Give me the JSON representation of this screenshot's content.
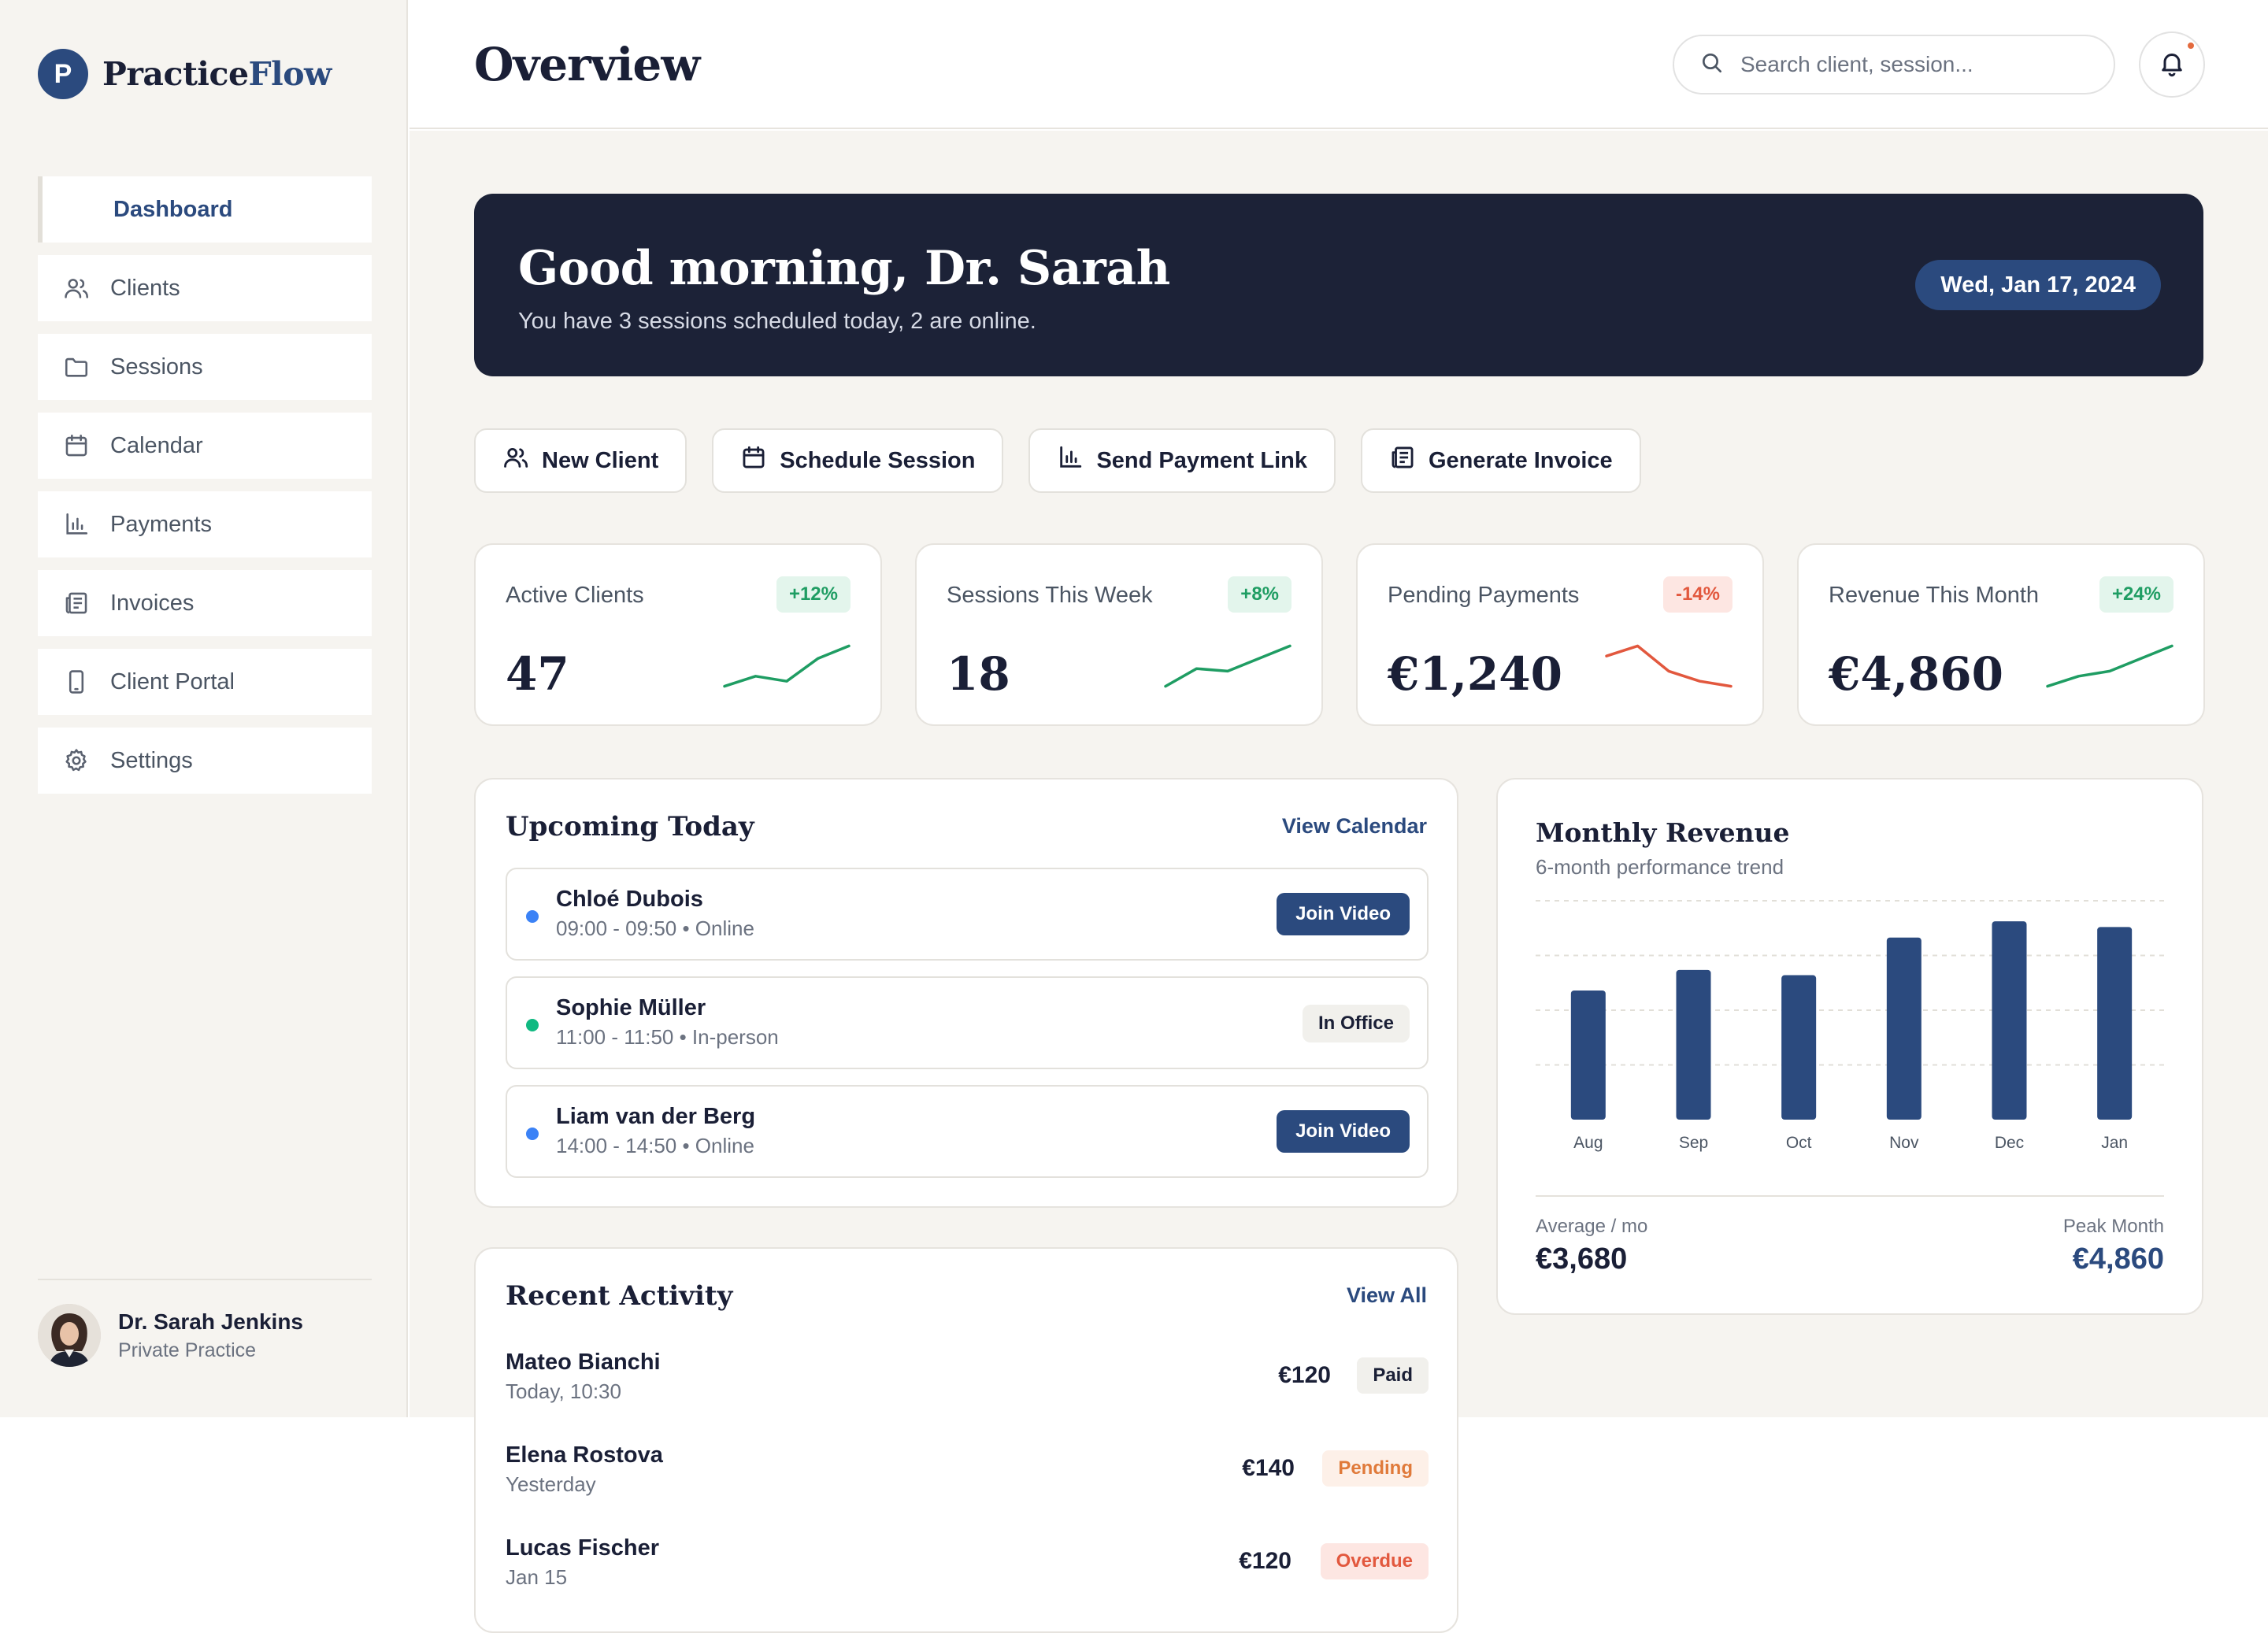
{
  "brand": {
    "logo_letter": "P",
    "name_part1": "Practice",
    "name_part2": "Flow"
  },
  "sidebar": {
    "items": [
      {
        "label": "Dashboard",
        "icon": "none",
        "active": true
      },
      {
        "label": "Clients",
        "icon": "users-icon"
      },
      {
        "label": "Sessions",
        "icon": "folder-icon"
      },
      {
        "label": "Calendar",
        "icon": "calendar-icon"
      },
      {
        "label": "Payments",
        "icon": "bar-chart-icon"
      },
      {
        "label": "Invoices",
        "icon": "newspaper-icon"
      },
      {
        "label": "Client Portal",
        "icon": "phone-icon"
      },
      {
        "label": "Settings",
        "icon": "gear-icon"
      }
    ]
  },
  "profile": {
    "name": "Dr. Sarah Jenkins",
    "subtitle": "Private Practice"
  },
  "header": {
    "title": "Overview",
    "search_placeholder": "Search client, session..."
  },
  "hero": {
    "greeting": "Good morning, Dr. Sarah",
    "subtitle": "You have 3 sessions scheduled today, 2 are online.",
    "date": "Wed, Jan 17, 2024"
  },
  "actions": [
    {
      "label": "New Client",
      "icon": "users-icon"
    },
    {
      "label": "Schedule Session",
      "icon": "calendar-icon"
    },
    {
      "label": "Send Payment Link",
      "icon": "bar-chart-icon"
    },
    {
      "label": "Generate Invoice",
      "icon": "newspaper-icon"
    }
  ],
  "stats": [
    {
      "label": "Active Clients",
      "value": "47",
      "change": "+12%",
      "trend": "up",
      "spark": [
        0.1,
        0.3,
        0.2,
        0.65,
        0.9
      ]
    },
    {
      "label": "Sessions This Week",
      "value": "18",
      "change": "+8%",
      "trend": "up",
      "spark": [
        0.1,
        0.45,
        0.4,
        0.65,
        0.9
      ]
    },
    {
      "label": "Pending Payments",
      "value": "€1,240",
      "change": "-14%",
      "trend": "down",
      "spark": [
        0.7,
        0.9,
        0.4,
        0.2,
        0.1
      ]
    },
    {
      "label": "Revenue This Month",
      "value": "€4,860",
      "change": "+24%",
      "trend": "up",
      "spark": [
        0.1,
        0.3,
        0.4,
        0.65,
        0.9
      ]
    }
  ],
  "upcoming": {
    "title": "Upcoming Today",
    "link": "View Calendar",
    "sessions": [
      {
        "name": "Chloé Dubois",
        "meta": "09:00 - 09:50 • Online",
        "dot_color": "#3b82f6",
        "action": "Join Video",
        "action_type": "button"
      },
      {
        "name": "Sophie Müller",
        "meta": "11:00 - 11:50 • In-person",
        "dot_color": "#10b981",
        "action": "In Office",
        "action_type": "tag"
      },
      {
        "name": "Liam van der Berg",
        "meta": "14:00 - 14:50 • Online",
        "dot_color": "#3b82f6",
        "action": "Join Video",
        "action_type": "button"
      }
    ]
  },
  "recent": {
    "title": "Recent Activity",
    "link": "View All",
    "items": [
      {
        "name": "Mateo Bianchi",
        "when": "Today, 10:30",
        "amount": "€120",
        "status": "Paid"
      },
      {
        "name": "Elena Rostova",
        "when": "Yesterday",
        "amount": "€140",
        "status": "Pending"
      },
      {
        "name": "Lucas Fischer",
        "when": "Jan 15",
        "amount": "€120",
        "status": "Overdue"
      }
    ]
  },
  "revenue": {
    "title": "Monthly Revenue",
    "subtitle": "6-month performance trend",
    "average_label": "Average / mo",
    "average_value": "€3,680",
    "peak_label": "Peak Month",
    "peak_value": "€4,860"
  },
  "chart_data": {
    "type": "bar",
    "title": "Monthly Revenue",
    "categories": [
      "Aug",
      "Sep",
      "Oct",
      "Nov",
      "Dec",
      "Jan"
    ],
    "values": [
      2950,
      3420,
      3300,
      4160,
      4530,
      4400
    ],
    "ylim": [
      0,
      5000
    ],
    "grid": true,
    "color": "#2b4a7e"
  },
  "colors": {
    "accent": "#2b4a7e",
    "dark": "#1c2237",
    "up": "#1f9d63",
    "down": "#e2583e",
    "background": "#f6f4f0"
  }
}
